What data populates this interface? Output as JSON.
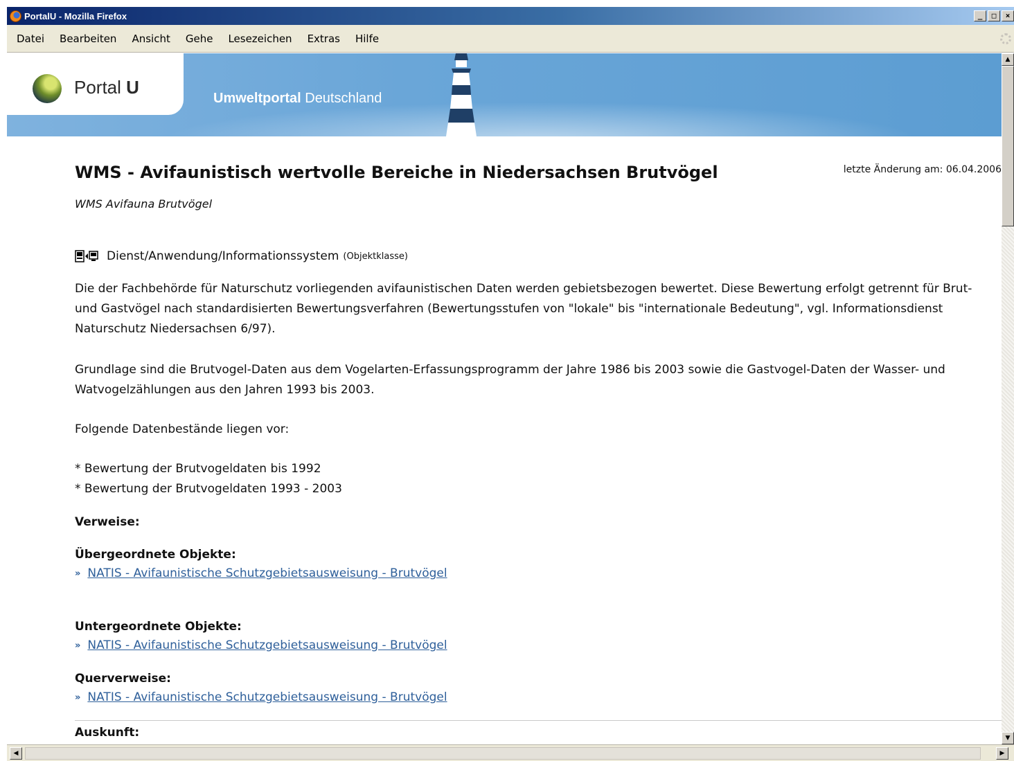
{
  "window": {
    "title": "PortalU - Mozilla Firefox"
  },
  "menu": [
    "Datei",
    "Bearbeiten",
    "Ansicht",
    "Gehe",
    "Lesezeichen",
    "Extras",
    "Hilfe"
  ],
  "header": {
    "logo_text_normal": "Portal",
    "logo_text_bold": "U",
    "tagline_bold": "Umweltportal",
    "tagline_rest": " Deutschland"
  },
  "page": {
    "title": "WMS - Avifaunistisch wertvolle Bereiche in Niedersachsen Brutvögel",
    "last_change": "letzte Änderung am: 06.04.2006",
    "subtitle": "WMS Avifauna Brutvögel",
    "object_class_name": "Dienst/Anwendung/Informationssystem",
    "object_class_suffix": "(Objektklasse)",
    "icon": "service-icon",
    "description_1": "Die der Fachbehörde für Naturschutz vorliegenden avifaunistischen Daten werden gebietsbezogen bewertet. Diese Bewertung erfolgt getrennt für Brut- und Gastvögel nach standardisierten Bewertungsverfahren (Bewertungsstufen von \"lokale\" bis \"internationale Bedeutung\", vgl. Informationsdienst Naturschutz Niedersachsen 6/97).",
    "description_2": "Grundlage sind die Brutvogel-Daten aus dem Vogelarten-Erfassungsprogramm der Jahre 1986 bis 2003 sowie die Gastvogel-Daten der Wasser- und Watvogelzählungen aus den Jahren 1993 bis 2003.",
    "description_3": "Folgende Datenbestände liegen vor:",
    "bullet_1": "* Bewertung der Brutvogeldaten bis 1992",
    "bullet_2": "* Bewertung der Brutvogeldaten 1993 - 2003"
  },
  "references": {
    "heading": "Verweise:",
    "parent_heading": "Übergeordnete Objekte:",
    "parent_link": "NATIS - Avifaunistische Schutzgebietsausweisung - Brutvögel",
    "child_heading": "Untergeordnete Objekte:",
    "child_link": "NATIS - Avifaunistische Schutzgebietsausweisung - Brutvögel",
    "cross_heading": "Querverweise:",
    "cross_link": "NATIS - Avifaunistische Schutzgebietsausweisung - Brutvögel",
    "link_marker": "»"
  },
  "info": {
    "heading": "Auskunft:"
  },
  "colors": {
    "link": "#2e5f9a",
    "header_blue": "#6aa6d8",
    "title_bar": "#0a246a"
  }
}
